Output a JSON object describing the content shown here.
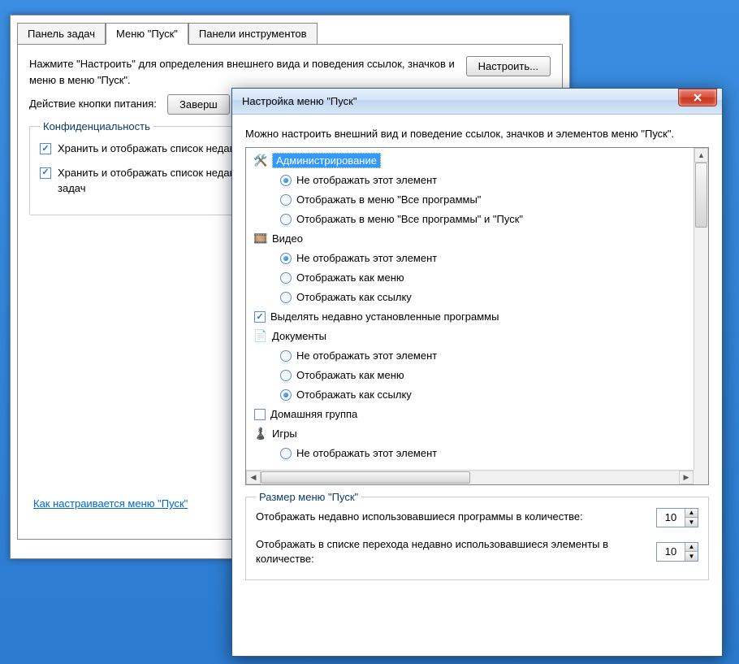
{
  "back": {
    "tabs": {
      "taskbar": "Панель задач",
      "start_menu": "Меню \"Пуск\"",
      "toolbars": "Панели инструментов"
    },
    "description": "Нажмите \"Настроить\" для определения внешнего вида и поведения ссылок, значков и меню в меню \"Пуск\".",
    "customize_btn": "Настроить...",
    "power_label": "Действие кнопки питания:",
    "power_btn": "Заверш",
    "privacy_title": "Конфиденциальность",
    "privacy1": "Хранить и отображать список недавно открывавшихся программ в меню \"Пуск\"",
    "privacy2": "Хранить и отображать список недавно открывавшихся элементов в меню \"Пуск\" и на панели задач",
    "help_link": "Как настраивается меню \"Пуск\""
  },
  "front": {
    "title": "Настройка меню \"Пуск\"",
    "intro": "Можно настроить внешний вид и поведение ссылок, значков и элементов меню \"Пуск\".",
    "close_x": "X",
    "tree": {
      "admin": "Администрирование",
      "admin_o1": "Не отображать этот элемент",
      "admin_o2": "Отображать в меню \"Все программы\"",
      "admin_o3": "Отображать в меню \"Все программы\" и \"Пуск\"",
      "video": "Видео",
      "video_o1": "Не отображать этот элемент",
      "video_o2": "Отображать как меню",
      "video_o3": "Отображать как ссылку",
      "highlight": "Выделять недавно установленные программы",
      "docs": "Документы",
      "docs_o1": "Не отображать этот элемент",
      "docs_o2": "Отображать как меню",
      "docs_o3": "Отображать как ссылку",
      "homegroup": "Домашняя группа",
      "games": "Игры",
      "games_o1": "Не отображать этот элемент"
    },
    "size_title": "Размер меню \"Пуск\"",
    "size_row1": "Отображать недавно использовавшиеся программы в количестве:",
    "size_val1": "10",
    "size_row2": "Отображать в списке перехода недавно использовавшиеся элементы в количестве:",
    "size_val2": "10"
  }
}
